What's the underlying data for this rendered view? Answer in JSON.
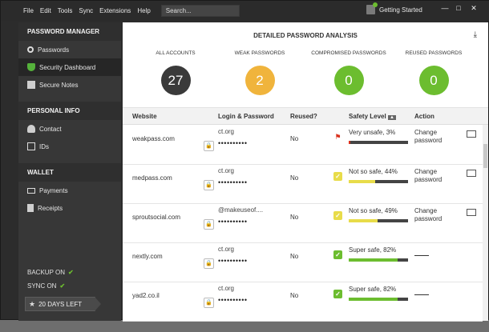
{
  "menubar": {
    "items": [
      "File",
      "Edit",
      "Tools",
      "Sync",
      "Extensions",
      "Help"
    ],
    "search_placeholder": "Search...",
    "getting_started": "Getting Started",
    "window_controls": [
      "—",
      "□",
      "✕"
    ]
  },
  "sidebar": {
    "sections": [
      {
        "title": "PASSWORD MANAGER",
        "items": [
          {
            "label": "Passwords",
            "icon": "key-icon"
          },
          {
            "label": "Security Dashboard",
            "icon": "shield-icon",
            "active": true
          },
          {
            "label": "Secure Notes",
            "icon": "note-icon"
          }
        ]
      },
      {
        "title": "PERSONAL INFO",
        "items": [
          {
            "label": "Contact",
            "icon": "person-icon"
          },
          {
            "label": "IDs",
            "icon": "id-icon"
          }
        ]
      },
      {
        "title": "WALLET",
        "items": [
          {
            "label": "Payments",
            "icon": "card-icon"
          },
          {
            "label": "Receipts",
            "icon": "receipt-icon"
          }
        ]
      }
    ],
    "backup": "BACKUP ON",
    "sync": "SYNC ON",
    "days_left": "20 DAYS LEFT"
  },
  "analysis": {
    "title": "DETAILED PASSWORD ANALYSIS",
    "metrics": [
      {
        "label": "ALL ACCOUNTS",
        "value": "27",
        "color": "#3a3a3a"
      },
      {
        "label": "WEAK PASSWORDS",
        "value": "2",
        "color": "#f0b43c"
      },
      {
        "label": "COMPROMISED PASSWORDS",
        "value": "0",
        "color": "#6cbd2f"
      },
      {
        "label": "REUSED PASSWORDS",
        "value": "0",
        "color": "#6cbd2f"
      }
    ]
  },
  "table": {
    "headers": {
      "website": "Website",
      "login": "Login & Password",
      "reused": "Reused?",
      "safety": "Safety Level",
      "action": "Action"
    },
    "rows": [
      {
        "website": "weakpass.com",
        "login": "ct.org",
        "password": "••••••••••",
        "reused": "No",
        "safety": "Very unsafe, 3%",
        "safety_level": 0.03,
        "level_color": "#d9301c",
        "icon": "flag-icon",
        "action": "Change password"
      },
      {
        "website": "medpass.com",
        "login": "ct.org",
        "password": "••••••••••",
        "reused": "No",
        "safety": "Not so safe, 44%",
        "safety_level": 0.44,
        "level_color": "#e8dc4a",
        "icon": "check-icon",
        "action": "Change password"
      },
      {
        "website": "sproutsocial.com",
        "login": "@makeuseof....",
        "password": "••••••••••",
        "reused": "No",
        "safety": "Not so safe, 49%",
        "safety_level": 0.49,
        "level_color": "#e8dc4a",
        "icon": "check-icon",
        "action": "Change password"
      },
      {
        "website": "nextly.com",
        "login": "ct.org",
        "password": "••••••••••",
        "reused": "No",
        "safety": "Super safe, 82%",
        "safety_level": 0.82,
        "level_color": "#6cbd2f",
        "icon": "check-icon",
        "action": ""
      },
      {
        "website": "yad2.co.il",
        "login": "ct.org",
        "password": "••••••••••",
        "reused": "No",
        "safety": "Super safe, 82%",
        "safety_level": 0.82,
        "level_color": "#6cbd2f",
        "icon": "check-icon",
        "action": ""
      }
    ]
  }
}
